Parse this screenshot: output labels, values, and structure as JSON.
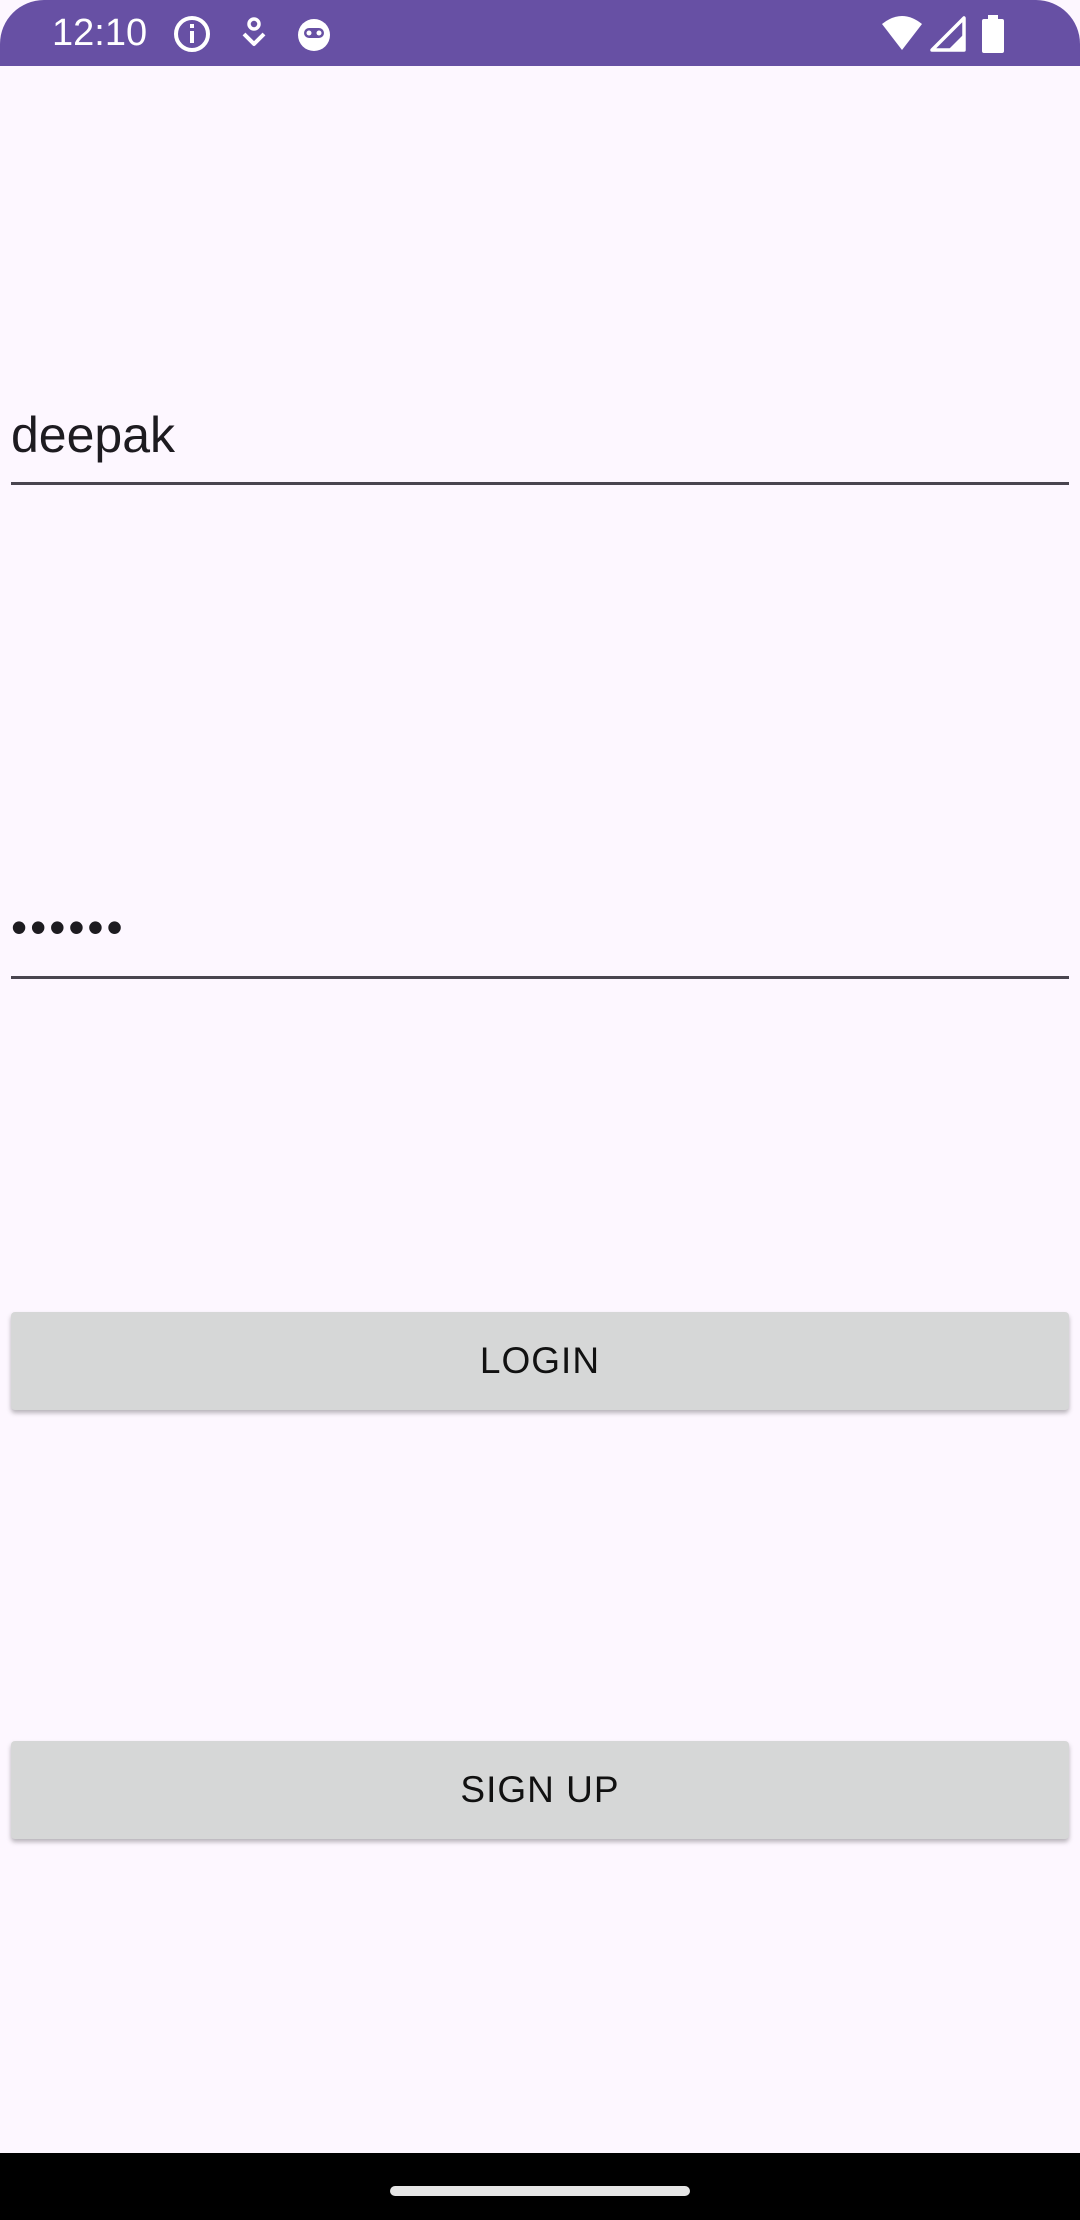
{
  "status_bar": {
    "time": "12:10",
    "background": "#6750a4",
    "left_icons": [
      "info-icon",
      "download-icon",
      "cat-face-icon"
    ],
    "right_icons": [
      "wifi-icon",
      "signal-icon",
      "battery-icon"
    ]
  },
  "form": {
    "username_value": "deepak",
    "password_value": "••••••",
    "login_label": "LOGIN",
    "signup_label": "SIGN UP"
  },
  "colors": {
    "background": "#fdf7ff",
    "button": "#d6d7d7",
    "underline": "#49454f"
  }
}
